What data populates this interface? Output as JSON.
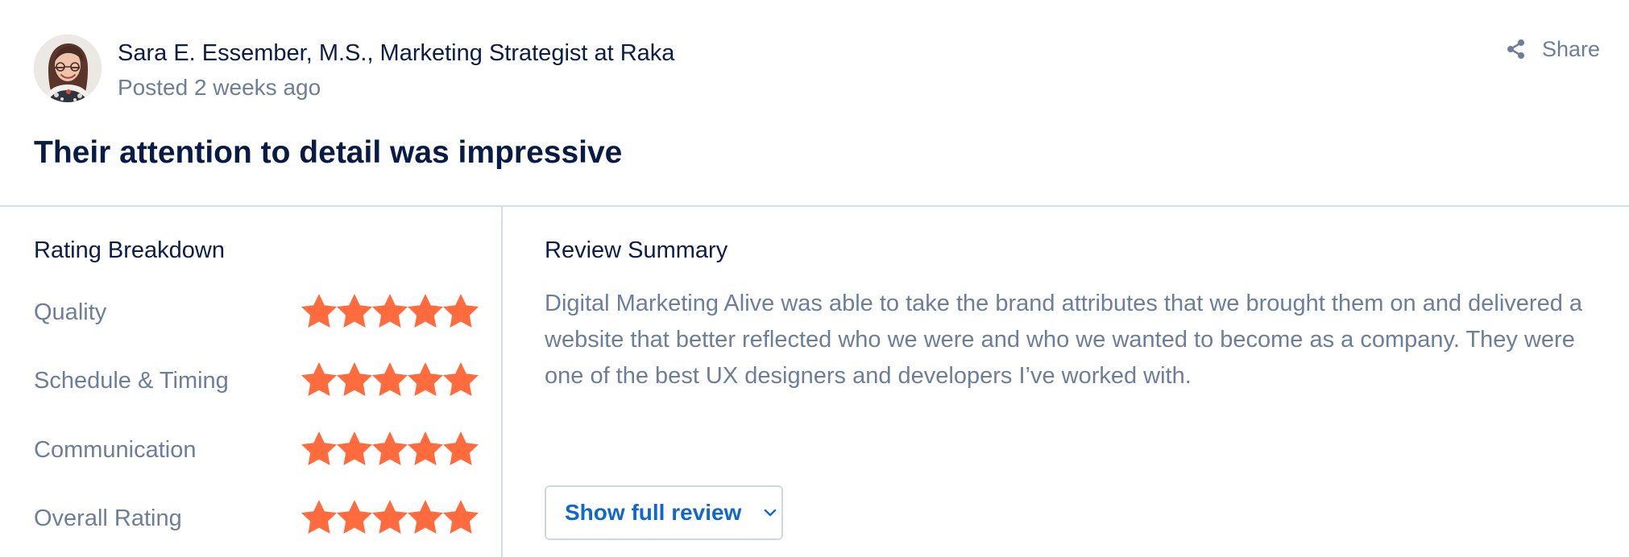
{
  "reviewer": {
    "name": "Sara E. Essember, M.S., Marketing Strategist at Raka",
    "posted": "Posted 2 weeks ago"
  },
  "share": {
    "label": "Share",
    "icon": "share-icon"
  },
  "review": {
    "title": "Their attention to detail was impressive"
  },
  "rating_breakdown": {
    "heading": "Rating Breakdown",
    "items": [
      {
        "label": "Quality",
        "stars": 5,
        "max": 5
      },
      {
        "label": "Schedule & Timing",
        "stars": 5,
        "max": 5
      },
      {
        "label": "Communication",
        "stars": 5,
        "max": 5
      },
      {
        "label": "Overall Rating",
        "stars": 5,
        "max": 5
      }
    ]
  },
  "summary": {
    "heading": "Review Summary",
    "text": "Digital Marketing Alive was able to take the brand attributes that we brought them on and delivered a website that better reflected who we were and who we wanted to become as a company. They were one of the best UX designers and developers I’ve worked with.",
    "button_label": "Show full review"
  },
  "colors": {
    "title": "#081b45",
    "muted": "#6d7f98",
    "star": "#ff6b3d",
    "link": "#1267cc",
    "divider": "#d5dde8"
  }
}
